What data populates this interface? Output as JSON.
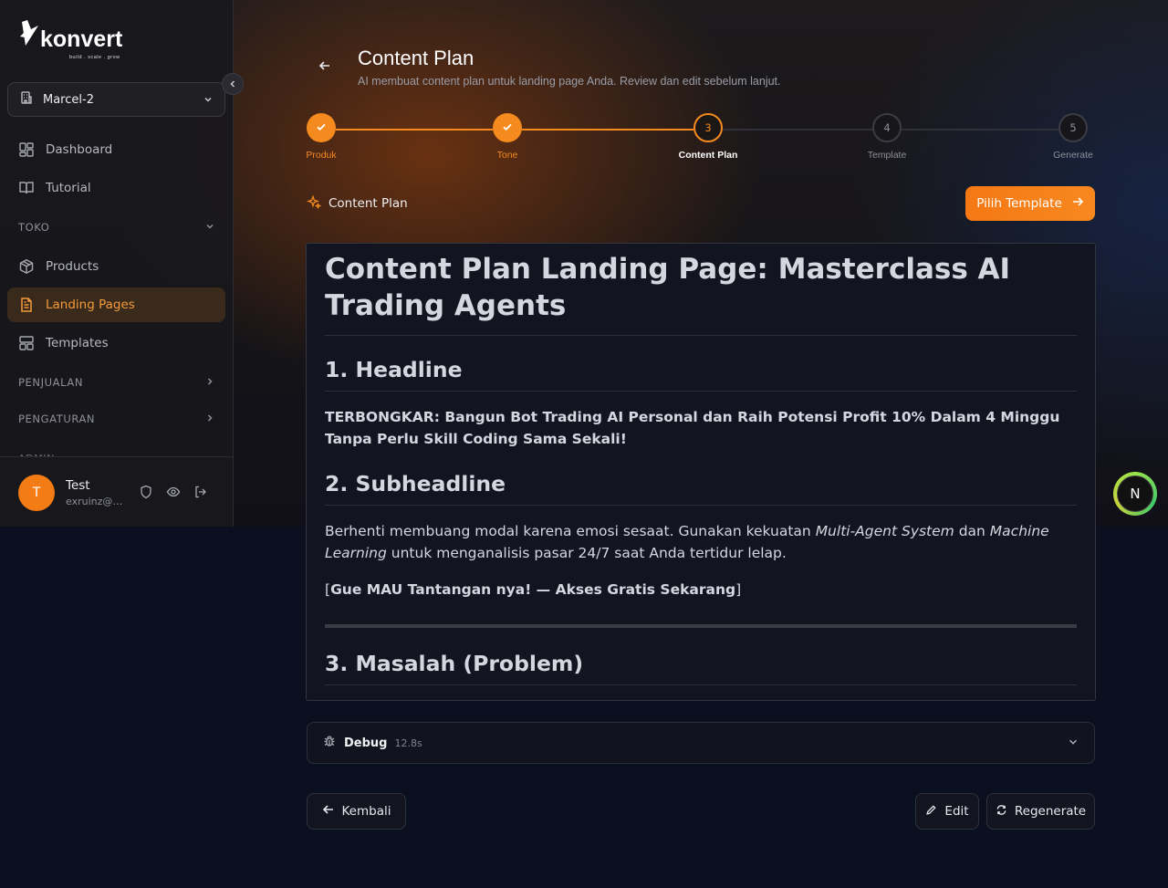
{
  "brand": {
    "name": "konvert",
    "tagline": "build . scale . grow",
    "accent": "#f58a1f"
  },
  "sidebar": {
    "workspace": "Marcel-2",
    "items": [
      {
        "label": "Dashboard",
        "icon": "dashboard-icon"
      },
      {
        "label": "Tutorial",
        "icon": "book-icon"
      }
    ],
    "toko_label": "TOKO",
    "toko_items": [
      {
        "label": "Products",
        "icon": "box-icon"
      },
      {
        "label": "Landing Pages",
        "icon": "document-icon",
        "active": true
      },
      {
        "label": "Templates",
        "icon": "templates-icon"
      }
    ],
    "sections": [
      {
        "label": "PENJUALAN"
      },
      {
        "label": "PENGATURAN"
      }
    ],
    "faded_section": "ADMIN"
  },
  "user": {
    "initial": "T",
    "name": "Test",
    "email": "exruinz@gmail.com"
  },
  "header": {
    "title": "Content Plan",
    "subtitle": "AI membuat content plan untuk landing page Anda. Review dan edit sebelum lanjut."
  },
  "stepper": [
    {
      "number": "1",
      "label": "Produk",
      "status": "done"
    },
    {
      "number": "2",
      "label": "Tone",
      "status": "done"
    },
    {
      "number": "3",
      "label": "Content Plan",
      "status": "current"
    },
    {
      "number": "4",
      "label": "Template",
      "status": "todo"
    },
    {
      "number": "5",
      "label": "Generate",
      "status": "todo"
    }
  ],
  "section": {
    "label": "Content Plan",
    "primary_button": "Pilih Template"
  },
  "content": {
    "h1": "Content Plan Landing Page: Masterclass AI Trading Agents",
    "headline_title": "1. Headline",
    "headline_text": "TERBONGKAR: Bangun Bot Trading AI Personal dan Raih Potensi Profit 10% Dalam 4 Minggu Tanpa Perlu Skill Coding Sama Sekali!",
    "subheadline_title": "2. Subheadline",
    "sub_text_1": "Berhenti membuang modal karena emosi sesaat. Gunakan kekuatan ",
    "sub_em_1": "Multi-Agent System",
    "sub_text_2": " dan ",
    "sub_em_2": "Machine Learning",
    "sub_text_3": " untuk menganalisis pasar 24/7 saat Anda tertidur lelap.",
    "cta_open": "[",
    "cta_text": "Gue MAU Tantangan nya! — Akses Gratis Sekarang",
    "cta_close": "]",
    "problem_title": "3. Masalah (Problem)"
  },
  "debug": {
    "label": "Debug",
    "time": "12.8s"
  },
  "actions": {
    "back": "Kembali",
    "edit": "Edit",
    "regenerate": "Regenerate"
  },
  "floating_badge": "N"
}
